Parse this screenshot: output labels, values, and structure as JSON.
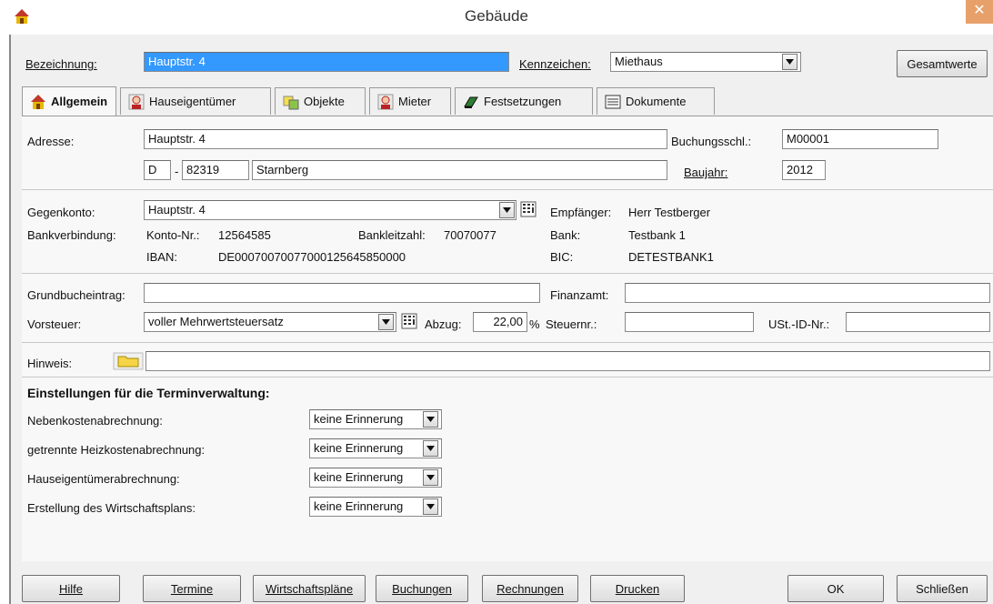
{
  "window": {
    "title": "Gebäude",
    "close_glyph": "✕"
  },
  "header": {
    "bezeichnung_label": "Bezeichnung:",
    "bezeichnung_value": "Hauptstr. 4",
    "kennzeichen_label": "Kennzeichen:",
    "kennzeichen_value": "Miethaus",
    "gesamtwerte_button": "Gesamtwerte"
  },
  "tabs": [
    {
      "label": "Allgemein",
      "icon": "house-icon",
      "active": true
    },
    {
      "label": "Hauseigentümer",
      "icon": "person-icon"
    },
    {
      "label": "Objekte",
      "icon": "objects-icon"
    },
    {
      "label": "Mieter",
      "icon": "person-icon"
    },
    {
      "label": "Festsetzungen",
      "icon": "book-icon"
    },
    {
      "label": "Dokumente",
      "icon": "document-icon"
    }
  ],
  "address": {
    "label": "Adresse:",
    "street": "Hauptstr. 4",
    "country": "D",
    "dash": "-",
    "zip": "82319",
    "city": "Starnberg",
    "buchungsschl_label": "Buchungsschl.:",
    "buchungsschl_value": "M00001",
    "baujahr_label": "Baujahr:",
    "baujahr_value": "2012"
  },
  "bank": {
    "gegenkonto_label": "Gegenkonto:",
    "gegenkonto_value": "Hauptstr. 4",
    "empfaenger_label": "Empfänger:",
    "empfaenger_value": "Herr Testberger",
    "bankverbindung_label": "Bankverbindung:",
    "kontonr_label": "Konto-Nr.:",
    "kontonr_value": "12564585",
    "blz_label": "Bankleitzahl:",
    "blz_value": "70070077",
    "bank_label": "Bank:",
    "bank_value": "Testbank 1",
    "iban_label": "IBAN:",
    "iban_value": "DE00070070077000125645850000",
    "bic_label": "BIC:",
    "bic_value": "DETESTBANK1"
  },
  "tax": {
    "grundbuch_label": "Grundbucheintrag:",
    "grundbuch_value": "",
    "finanzamt_label": "Finanzamt:",
    "finanzamt_value": "",
    "vorsteuer_label": "Vorsteuer:",
    "vorsteuer_value": "voller Mehrwertsteuersatz",
    "abzug_label": "Abzug:",
    "abzug_value": "22,00",
    "abzug_unit": "%",
    "steuernr_label": "Steuernr.:",
    "steuernr_value": "",
    "ustid_label": "USt.-ID-Nr.:",
    "ustid_value": ""
  },
  "hinweis": {
    "label": "Hinweis:",
    "value": ""
  },
  "termin": {
    "heading": "Einstellungen für die Terminverwaltung:",
    "rows": [
      {
        "label": "Nebenkostenabrechnung:",
        "value": "keine Erinnerung"
      },
      {
        "label": "getrennte Heizkostenabrechnung:",
        "value": "keine Erinnerung"
      },
      {
        "label": "Hauseigentümerabrechnung:",
        "value": "keine Erinnerung"
      },
      {
        "label": "Erstellung des Wirtschaftsplans:",
        "value": "keine Erinnerung"
      }
    ]
  },
  "buttons": {
    "hilfe": "Hilfe",
    "termine": "Termine",
    "wirtschaftsplaene": "Wirtschaftspläne",
    "buchungen": "Buchungen",
    "rechnungen": "Rechnungen",
    "drucken": "Drucken",
    "ok": "OK",
    "schliessen": "Schließen"
  }
}
